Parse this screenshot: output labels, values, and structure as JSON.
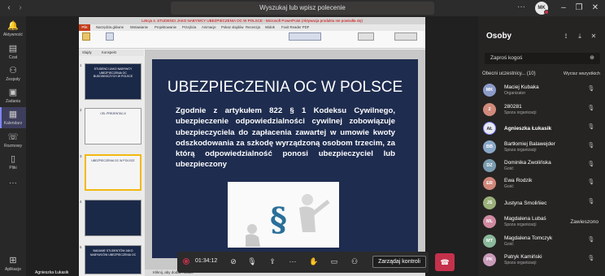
{
  "topbar": {
    "search_placeholder": "Wyszukaj lub wpisz polecenie",
    "avatar_initials": "MK",
    "menu": "···"
  },
  "rail": [
    {
      "label": "Aktywność",
      "icon": "bell-icon"
    },
    {
      "label": "Czat",
      "icon": "chat-icon"
    },
    {
      "label": "Zespoły",
      "icon": "teams-icon"
    },
    {
      "label": "Zadania",
      "icon": "assignments-icon"
    },
    {
      "label": "Kalendarz",
      "icon": "calendar-icon"
    },
    {
      "label": "Rozmowy",
      "icon": "phone-icon"
    },
    {
      "label": "Pliki",
      "icon": "files-icon"
    },
    {
      "label": "···",
      "icon": "more-icon"
    },
    {
      "label": "Aplikacje",
      "icon": "apps-icon"
    }
  ],
  "ppt": {
    "title": "Lekcja 4. STUDENCI JAKO NABYWCY UBEZPIECZENIA OC W POLSCE - Microsoft PowerPoint (Aktywacja produktu nie powiodła się)",
    "tabs": [
      "Plik",
      "Narzędzia główne",
      "Wstawianie",
      "Projektowanie",
      "Przejścia",
      "Animacje",
      "Pokaz slajdów",
      "Recenzja",
      "Widok",
      "Foxit Reader PDF"
    ],
    "panel_tabs": [
      "Slajdy",
      "Konspekt"
    ],
    "thumbs": [
      {
        "num": "1",
        "text": "STUDENCI JAKO NABYWCY UBEZPIECZENIA OC BUDOWNICZYCH W POLSCE"
      },
      {
        "num": "2",
        "text": "CEL PREZENTACJI"
      },
      {
        "num": "3",
        "text": "UBEZPIECZENIA OC W POLSCE"
      },
      {
        "num": "4",
        "text": ""
      },
      {
        "num": "5",
        "text": "BADANIE STUDENTÓW JAKO NABYWCÓW UBEZPIECZENIA OC"
      }
    ],
    "slide_title": "UBEZPIECZENIA OC W POLSCE",
    "slide_body": "Zgodnie z artykułem 822 § 1 Kodeksu Cywilnego, ubezpieczenie odpowiedzialności cywilnej zobowiązuje ubezpieczyciela do zapłacenia zawartej w umowie kwoty odszkodowania za szkodę wyrządzoną osobom trzecim, za którą odpowiedzialność ponosi ubezpieczyciel lub ubezpieczony",
    "status": "Kliknij, aby dodać notatki"
  },
  "meeting": {
    "presenter_name": "Agnieszka Łukasik",
    "timer": "01:34:12",
    "manage_label": "Zarządaj kontroli"
  },
  "people": {
    "title": "Osoby",
    "invite_placeholder": "Zaproś kogoś",
    "section_label": "Obecni uczestnicy... (10)",
    "mute_all": "Wycisz wszystkich",
    "list": [
      {
        "initials": "MK",
        "name": "Maciej Kubaka",
        "role": "Organizator",
        "color": "#8b9bc8"
      },
      {
        "initials": "2",
        "name": "280281",
        "role": "Spoza organizacji",
        "color": "#d08a7c"
      },
      {
        "initials": "AŁ",
        "name": "Agnieszka Łukasik",
        "role": "",
        "color": "#e8e8f4"
      },
      {
        "initials": "BB",
        "name": "Bartłomiej Balawejder",
        "role": "Spoza organizacji",
        "color": "#8aa8c8"
      },
      {
        "initials": "DZ",
        "name": "Dominika Zwolińska",
        "role": "Gość",
        "color": "#7a9cb0"
      },
      {
        "initials": "ER",
        "name": "Ewa Rodzik",
        "role": "Gość",
        "color": "#d0877a"
      },
      {
        "initials": "JS",
        "name": "Justyna Smolińiec",
        "role": "",
        "color": "#9bb07a"
      },
      {
        "initials": "ML",
        "name": "Magdalena Lubaś",
        "role": "Spoza organizacji",
        "color": "#d08aa0",
        "state": "Zawieszono"
      },
      {
        "initials": "MT",
        "name": "Magdalena Tomczyk",
        "role": "Gość",
        "color": "#8ab89a"
      },
      {
        "initials": "PK",
        "name": "Patryk Kamiński",
        "role": "Spoza organizacji",
        "color": "#c89ab8"
      }
    ]
  }
}
